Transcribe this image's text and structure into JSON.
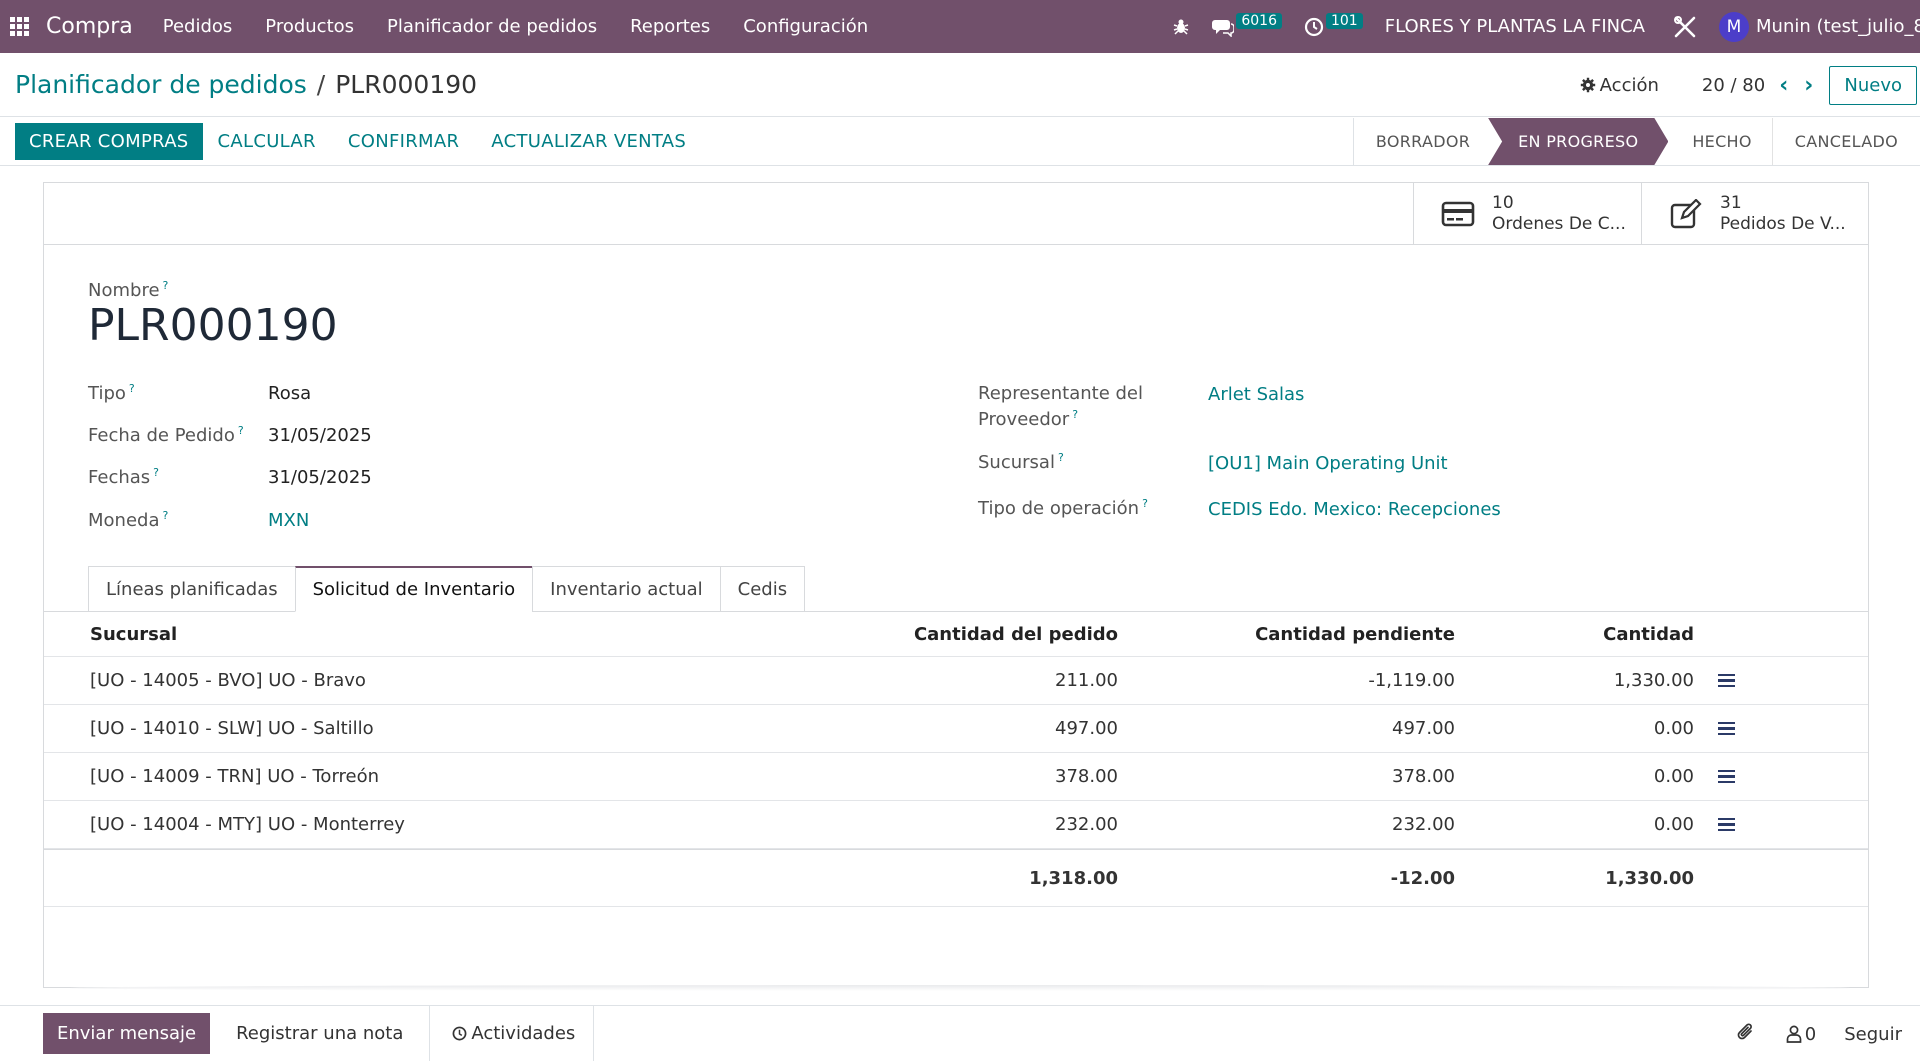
{
  "topnav": {
    "app_name": "Compra",
    "menu": [
      "Pedidos",
      "Productos",
      "Planificador de pedidos",
      "Reportes",
      "Configuración"
    ],
    "messages_count": "6016",
    "activities_count": "101",
    "company": "FLORES Y PLANTAS LA FINCA",
    "avatar_letter": "M",
    "user": "Munin (test_julio_8"
  },
  "control": {
    "breadcrumb_parent": "Planificador de pedidos",
    "breadcrumb_sep": "/",
    "breadcrumb_current": "PLR000190",
    "action_label": "Acción",
    "pager": "20 / 80",
    "new_label": "Nuevo"
  },
  "actions": {
    "create": "CREAR COMPRAS",
    "calculate": "CALCULAR",
    "confirm": "CONFIRMAR",
    "update_sales": "ACTUALIZAR VENTAS"
  },
  "stages": [
    "BORRADOR",
    "EN PROGRESO",
    "HECHO",
    "CANCELADO"
  ],
  "active_stage": "EN PROGRESO",
  "stat_buttons": {
    "orders_count": "10",
    "orders_label": "Ordenes De C...",
    "sales_count": "31",
    "sales_label": "Pedidos De V..."
  },
  "form": {
    "name_label": "Nombre",
    "name": "PLR000190",
    "tipo_label": "Tipo",
    "tipo": "Rosa",
    "fecha_pedido_label": "Fecha de Pedido",
    "fecha_pedido": "31/05/2025",
    "fechas_label": "Fechas",
    "fechas": "31/05/2025",
    "moneda_label": "Moneda",
    "moneda": "MXN",
    "rep_label_1": "Representante del",
    "rep_label_2": "Proveedor",
    "rep": "Arlet Salas",
    "sucursal_label": "Sucursal",
    "sucursal": "[OU1] Main Operating Unit",
    "tipo_op_label": "Tipo de operación",
    "tipo_op": "CEDIS Edo. Mexico: Recepciones",
    "help_mark": "?"
  },
  "tabs": [
    "Líneas planificadas",
    "Solicitud de Inventario",
    "Inventario actual",
    "Cedis"
  ],
  "active_tab": "Solicitud de Inventario",
  "table": {
    "headers": {
      "sucursal": "Sucursal",
      "pedido": "Cantidad del pedido",
      "pendiente": "Cantidad pendiente",
      "cantidad": "Cantidad"
    },
    "rows": [
      {
        "sucursal": "[UO - 14005 - BVO] UO - Bravo",
        "pedido": "211.00",
        "pendiente": "-1,119.00",
        "cantidad": "1,330.00"
      },
      {
        "sucursal": "[UO - 14010 - SLW] UO - Saltillo",
        "pedido": "497.00",
        "pendiente": "497.00",
        "cantidad": "0.00"
      },
      {
        "sucursal": "[UO - 14009 - TRN] UO - Torreón",
        "pedido": "378.00",
        "pendiente": "378.00",
        "cantidad": "0.00"
      },
      {
        "sucursal": "[UO - 14004 - MTY] UO - Monterrey",
        "pedido": "232.00",
        "pendiente": "232.00",
        "cantidad": "0.00"
      }
    ],
    "totals": {
      "pedido": "1,318.00",
      "pendiente": "-12.00",
      "cantidad": "1,330.00"
    }
  },
  "chatter": {
    "send": "Enviar mensaje",
    "note": "Registrar una nota",
    "activities": "Actividades",
    "followers": "0",
    "follow": "Seguir"
  }
}
